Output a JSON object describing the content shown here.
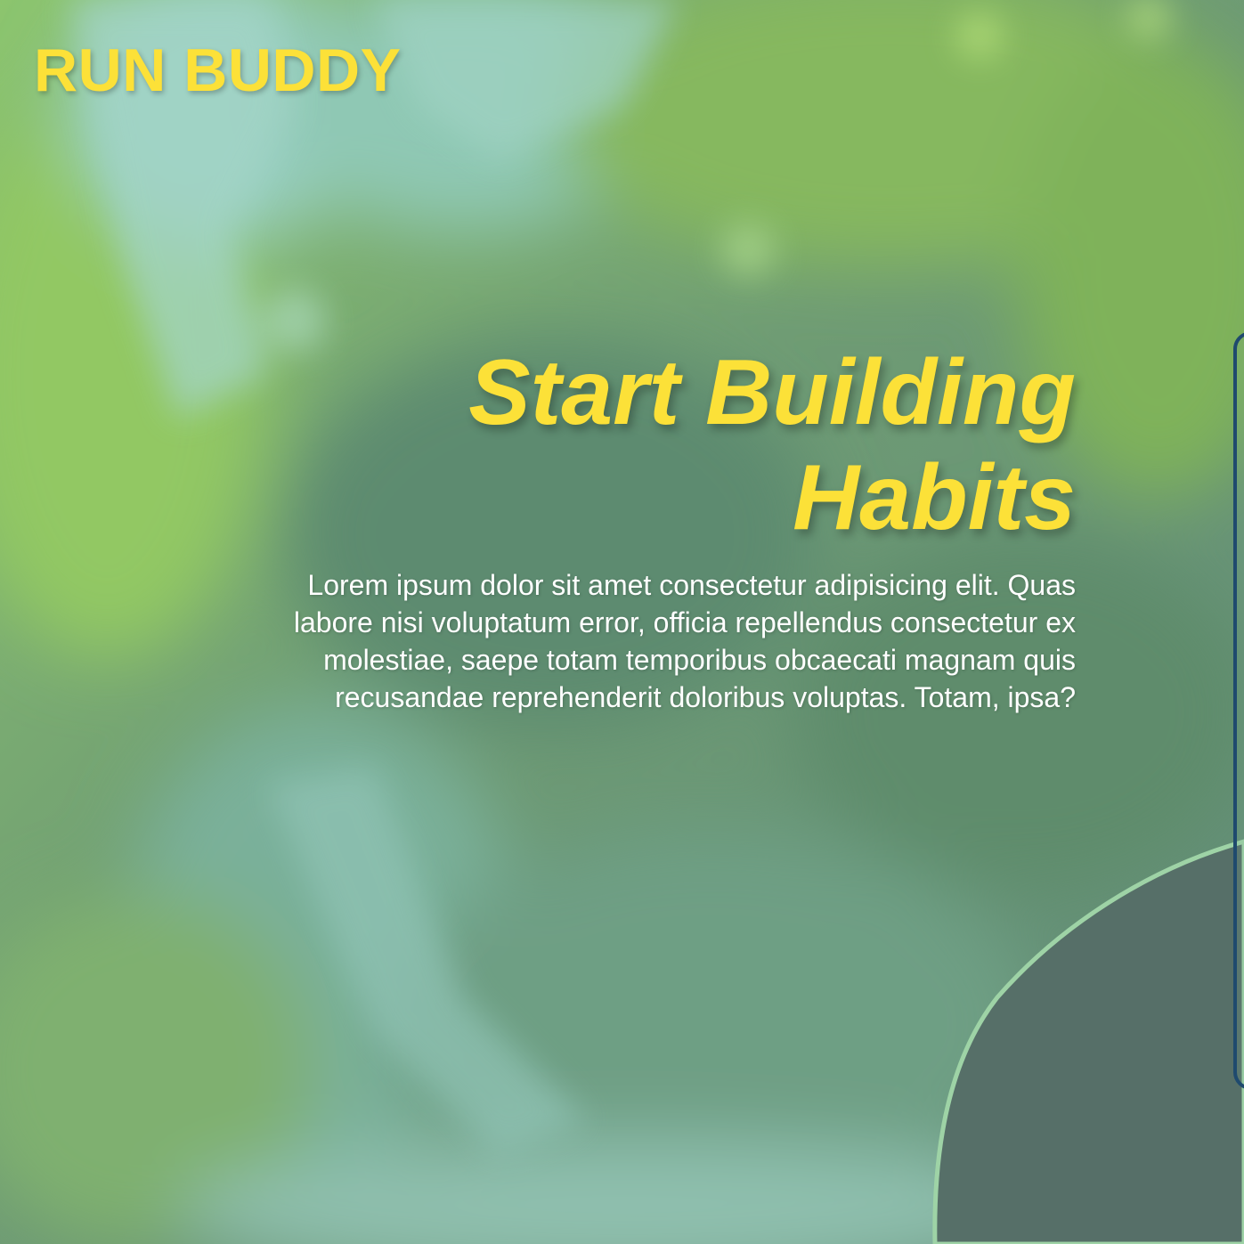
{
  "header": {
    "brand": "RUN BUDDY"
  },
  "hero": {
    "title_line1": "Start Building",
    "title_line2": "Habits",
    "description": "Lorem ipsum dolor sit amet consectetur adipisicing elit. Quas labore nisi voluptatum error, officia repellendus consectetur ex molestiae, saepe totam temporibus obcaecati magnam quis recusandae reprehenderit doloribus voluptas. Totam, ipsa?"
  },
  "colors": {
    "accent": "#fce138",
    "text": "#ffffff",
    "card_border": "#1f4a6e"
  }
}
